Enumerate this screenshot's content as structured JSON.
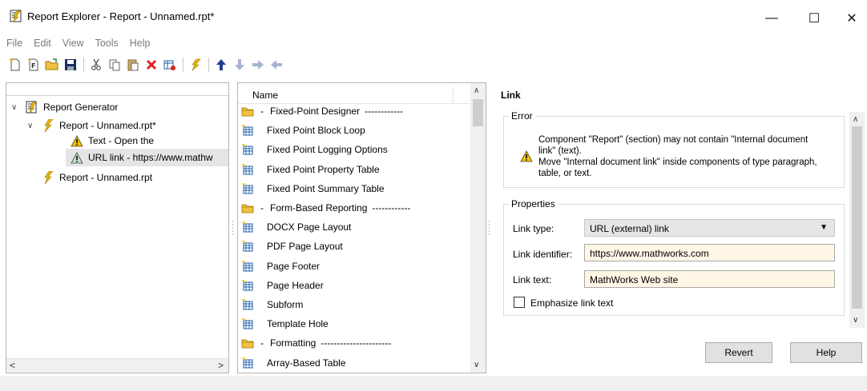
{
  "window": {
    "title": "Report Explorer - Report - Unnamed.rpt*",
    "minimize_glyph": "—",
    "maximize_glyph": "☐",
    "close_glyph": "✕"
  },
  "menu": [
    "File",
    "Edit",
    "View",
    "Tools",
    "Help"
  ],
  "toolbar": {
    "icons": [
      "new-report-icon",
      "new-form-icon",
      "open-icon",
      "save-icon",
      "cut-icon",
      "copy-icon",
      "paste-icon",
      "delete-icon",
      "disable-component-icon",
      "run-report-icon",
      "move-up-icon",
      "move-down-icon",
      "indent-icon",
      "outdent-icon"
    ]
  },
  "tree": {
    "items": [
      {
        "label": "Report Generator",
        "icon": "report-generator-icon",
        "expanded": true
      },
      {
        "label": "Report - Unnamed.rpt*",
        "icon": "report-lightning-icon",
        "expanded": true
      },
      {
        "label": "Text - Open the",
        "icon": "warning-icon"
      },
      {
        "label": "URL link - https://www.mathw",
        "icon": "warning-icon",
        "selected": true
      },
      {
        "label": "Report - Unnamed.rpt",
        "icon": "report-lightning-icon"
      }
    ]
  },
  "list": {
    "header": "Name",
    "rows": [
      {
        "type": "category",
        "label": "Fixed-Point Designer",
        "dashes": "------------"
      },
      {
        "type": "item",
        "label": "Fixed Point Block Loop"
      },
      {
        "type": "item",
        "label": "Fixed Point Logging Options"
      },
      {
        "type": "item",
        "label": "Fixed Point Property Table"
      },
      {
        "type": "item",
        "label": "Fixed Point Summary Table"
      },
      {
        "type": "category",
        "label": "Form-Based Reporting",
        "dashes": "------------"
      },
      {
        "type": "item",
        "label": "DOCX Page Layout"
      },
      {
        "type": "item",
        "label": "PDF Page Layout"
      },
      {
        "type": "item",
        "label": "Page Footer"
      },
      {
        "type": "item",
        "label": "Page Header"
      },
      {
        "type": "item",
        "label": "Subform"
      },
      {
        "type": "item",
        "label": "Template Hole"
      },
      {
        "type": "category",
        "label": "Formatting",
        "dashes": "----------------------"
      },
      {
        "type": "item",
        "label": "Array-Based Table"
      }
    ]
  },
  "properties_panel": {
    "title": "Link",
    "error_group_label": "Error",
    "error_message": "Component \"Report\" (section) may not contain \"Internal document link\" (text).\nMove \"Internal document link\" inside components of type paragraph, table, or text.",
    "properties_group_label": "Properties",
    "link_type_label": "Link type:",
    "link_type_value": "URL (external) link",
    "link_identifier_label": "Link identifier:",
    "link_identifier_value": "https://www.mathworks.com",
    "link_text_label": "Link text:",
    "link_text_value": "MathWorks Web site",
    "emphasize_label": "Emphasize link text",
    "emphasize_checked": false,
    "revert_label": "Revert",
    "help_label": "Help"
  },
  "colors": {
    "field_highlight": "#fff6e6",
    "lightning": "#e8b800",
    "warning": "#f2c200",
    "table_icon": "#1f5fa8",
    "folder": "#f0c040"
  }
}
